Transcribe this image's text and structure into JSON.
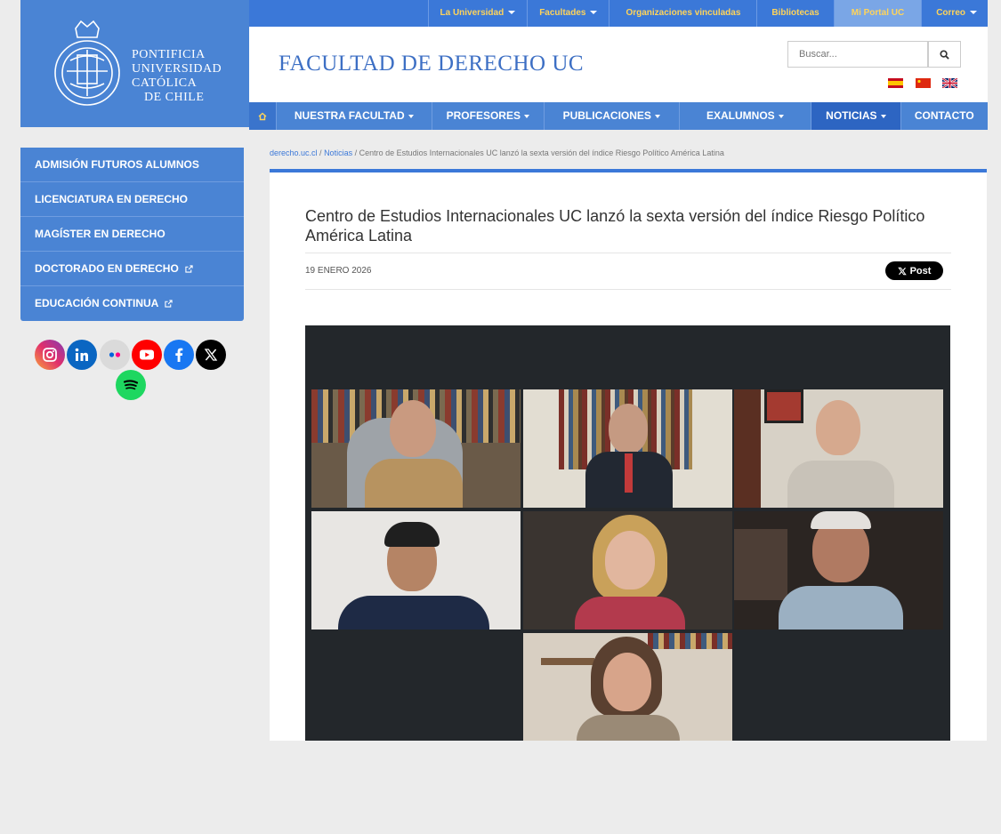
{
  "logo": {
    "lines": [
      "PONTIFICIA",
      "UNIVERSIDAD",
      "CATÓLICA",
      "DE CHILE"
    ]
  },
  "topbar": {
    "items": [
      {
        "label": "La Universidad",
        "dropdown": true
      },
      {
        "label": "Facultades",
        "dropdown": true
      },
      {
        "label": "Organizaciones vinculadas",
        "dropdown": false
      },
      {
        "label": "Bibliotecas",
        "dropdown": false
      },
      {
        "label": "Mi Portal UC",
        "dropdown": false,
        "active": true
      },
      {
        "label": "Correo",
        "dropdown": true
      }
    ]
  },
  "header": {
    "title": "FACULTAD DE DERECHO UC",
    "search_placeholder": "Buscar...",
    "flags": [
      "es-flag",
      "cn-flag",
      "uk-flag"
    ]
  },
  "mainnav": {
    "items": [
      {
        "label": "NUESTRA FACULTAD",
        "dropdown": true
      },
      {
        "label": "PROFESORES",
        "dropdown": true
      },
      {
        "label": "PUBLICACIONES",
        "dropdown": true
      },
      {
        "label": "EXALUMNOS",
        "dropdown": true
      },
      {
        "label": "NOTICIAS",
        "dropdown": true
      },
      {
        "label": "CONTACTO",
        "dropdown": false
      }
    ]
  },
  "sidebar": {
    "items": [
      {
        "label": "ADMISIÓN FUTUROS ALUMNOS",
        "external": false
      },
      {
        "label": "LICENCIATURA EN DERECHO",
        "external": false
      },
      {
        "label": "MAGÍSTER EN DERECHO",
        "external": false
      },
      {
        "label": "DOCTORADO EN DERECHO",
        "external": true
      },
      {
        "label": "EDUCACIÓN CONTINUA",
        "external": true
      }
    ],
    "social": [
      "instagram-icon",
      "linkedin-icon",
      "flickr-icon",
      "youtube-icon",
      "facebook-icon",
      "x-icon",
      "spotify-icon"
    ]
  },
  "breadcrumb": {
    "home": "derecho.uc.cl",
    "section": "Noticias",
    "current": "Centro de Estudios Internacionales UC lanzó la sexta versión del índice Riesgo Político América Latina"
  },
  "article": {
    "title": "Centro de Estudios Internacionales UC lanzó la sexta versión del índice Riesgo Político América Latina",
    "date": "19 ENERO 2026",
    "share_label": "Post"
  },
  "colors": {
    "primary": "#4a84d4",
    "topbar": "#3b78d8",
    "topbar_text": "#ffd45a",
    "title_blue": "#3d6fc4"
  }
}
